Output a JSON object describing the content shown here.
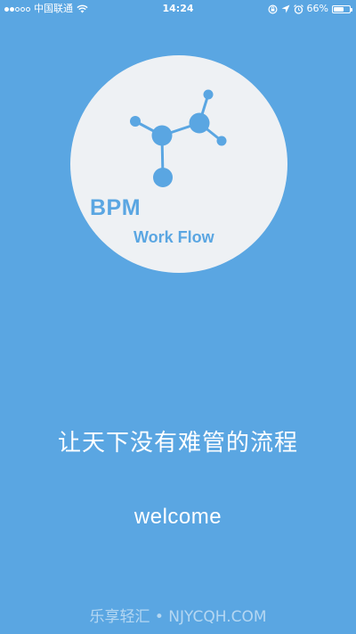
{
  "status_bar": {
    "carrier": "中国联通",
    "time": "14:24",
    "battery_percent_label": "66%",
    "battery_level": 0.66,
    "icons": [
      "signal-dots-icon",
      "wifi-icon",
      "rotation-lock-icon",
      "location-arrow-icon",
      "alarm-icon",
      "battery-icon"
    ]
  },
  "logo": {
    "title": "BPM",
    "subtitle": "Work Flow",
    "icon": "molecule-network-icon",
    "circle_color": "#eef1f4",
    "accent_color": "#5aa6e2"
  },
  "main": {
    "tagline": "让天下没有难管的流程",
    "welcome": "welcome"
  },
  "watermark": {
    "text": "乐享轻汇 • NJYCQH.COM"
  },
  "colors": {
    "background": "#5aa6e2",
    "text": "#ffffff"
  }
}
